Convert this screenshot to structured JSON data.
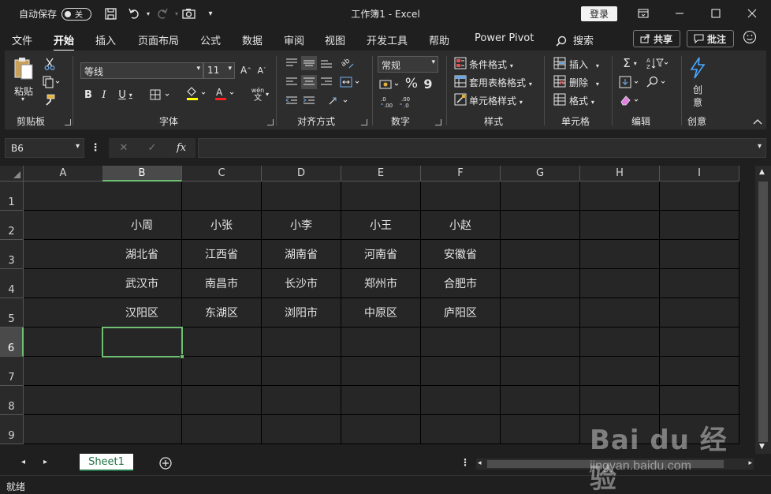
{
  "titlebar": {
    "autosave_label": "自动保存",
    "autosave_toggle": "关",
    "title": "工作簿1  -  Excel",
    "login_label": "登录"
  },
  "tabs": [
    {
      "label": "文件",
      "active": false
    },
    {
      "label": "开始",
      "active": true
    },
    {
      "label": "插入",
      "active": false
    },
    {
      "label": "页面布局",
      "active": false
    },
    {
      "label": "公式",
      "active": false
    },
    {
      "label": "数据",
      "active": false
    },
    {
      "label": "审阅",
      "active": false
    },
    {
      "label": "视图",
      "active": false
    },
    {
      "label": "开发工具",
      "active": false
    },
    {
      "label": "帮助",
      "active": false
    },
    {
      "label": "Power Pivot",
      "active": false
    },
    {
      "label": "搜索",
      "active": false
    }
  ],
  "share_label": "共享",
  "comment_label": "批注",
  "ribbon": {
    "clipboard": {
      "paste": "粘贴",
      "group": "剪贴板"
    },
    "font": {
      "name": "等线",
      "size": "11",
      "group": "字体",
      "wen": "wén",
      "wen_char": "文"
    },
    "align": {
      "group": "对齐方式"
    },
    "number": {
      "format": "常规",
      "group": "数字",
      "percent": "%",
      "comma": "9"
    },
    "styles": {
      "conditional": "条件格式",
      "table": "套用表格格式",
      "cell": "单元格样式",
      "group": "样式"
    },
    "cells": {
      "insert": "插入",
      "delete": "删除",
      "format": "格式",
      "group": "单元格"
    },
    "edit": {
      "group": "编辑"
    },
    "create": {
      "label1": "创",
      "label2": "意",
      "group": "创意"
    }
  },
  "formula_bar": {
    "name_box": "B6",
    "fx": "fx",
    "value": ""
  },
  "columns": [
    "A",
    "B",
    "C",
    "D",
    "E",
    "F",
    "G",
    "H",
    "I"
  ],
  "rows": [
    "1",
    "2",
    "3",
    "4",
    "5",
    "6",
    "7",
    "8",
    "9"
  ],
  "cells": [
    [
      "",
      "",
      "",
      "",
      "",
      "",
      "",
      "",
      ""
    ],
    [
      "",
      "小周",
      "小张",
      "小李",
      "小王",
      "小赵",
      "",
      "",
      ""
    ],
    [
      "",
      "湖北省",
      "江西省",
      "湖南省",
      "河南省",
      "安徽省",
      "",
      "",
      ""
    ],
    [
      "",
      "武汉市",
      "南昌市",
      "长沙市",
      "郑州市",
      "合肥市",
      "",
      "",
      ""
    ],
    [
      "",
      "汉阳区",
      "东湖区",
      "浏阳市",
      "中原区",
      "庐阳区",
      "",
      "",
      ""
    ],
    [
      "",
      "",
      "",
      "",
      "",
      "",
      "",
      "",
      ""
    ],
    [
      "",
      "",
      "",
      "",
      "",
      "",
      "",
      "",
      ""
    ],
    [
      "",
      "",
      "",
      "",
      "",
      "",
      "",
      "",
      ""
    ],
    [
      "",
      "",
      "",
      "",
      "",
      "",
      "",
      "",
      ""
    ]
  ],
  "selection": {
    "col": 1,
    "row": 5
  },
  "sheets": [
    "Sheet1"
  ],
  "status": "就绪",
  "watermark": {
    "text": "Bai du 经验",
    "url": "jingyan.baidu.com"
  },
  "colors": {
    "accent": "#217346",
    "selection": "#6fbf73",
    "background": "#1f1f1f"
  }
}
